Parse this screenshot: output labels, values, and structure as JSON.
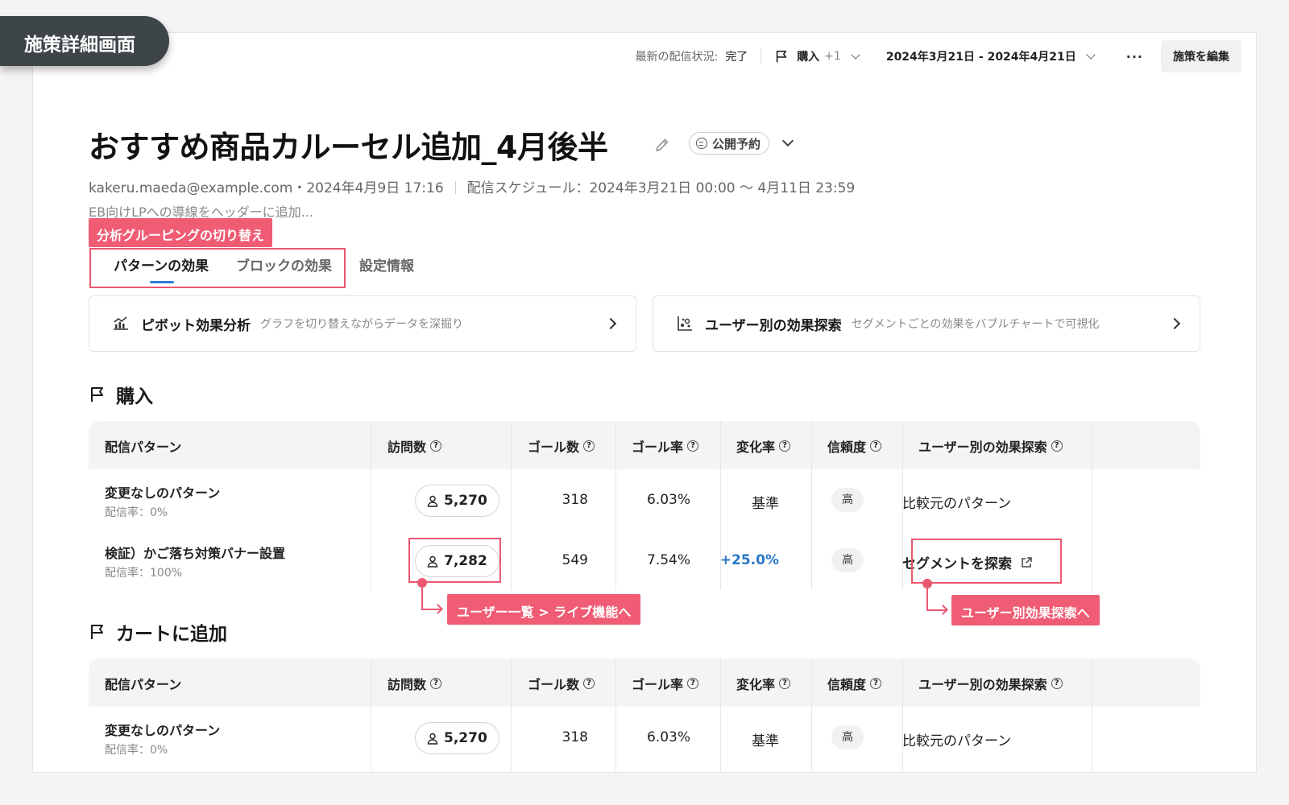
{
  "page_tag": "施策詳細画面",
  "topbar": {
    "status_label": "最新の配信状況:",
    "status_value": "完了",
    "goal_filter": "購入",
    "goal_extra": "+1",
    "date_range": "2024年3月21日 - 2024年4月21日",
    "more": "···",
    "edit_button": "施策を編集"
  },
  "header": {
    "title": "おすすめ商品カルーセル追加_4月後半",
    "status_badge": "公開予約",
    "author_date": "kakeru.maeda@example.com・2024年4月9日 17:16",
    "schedule": "配信スケジュール：2024年3月21日 00:00 〜 4月11日 23:59",
    "description": "EB向けLPへの導線をヘッダーに追加..."
  },
  "annotations": {
    "tabs": "分析グルーピングの切り替え",
    "visits": "ユーザー一覧 > ライブ機能へ",
    "explore": "ユーザー別効果探索へ"
  },
  "tabs": [
    "パターンの効果",
    "ブロックの効果",
    "設定情報"
  ],
  "analysis_cards": [
    {
      "title": "ピボット効果分析",
      "subtitle": "グラフを切り替えながらデータを深掘り",
      "icon": "chart-icon"
    },
    {
      "title": "ユーザー別の効果探索",
      "subtitle": "セグメントごとの効果をバブルチャートで可視化",
      "icon": "bubble-chart-icon"
    }
  ],
  "table_headers": [
    "配信パターン",
    "訪問数",
    "ゴール数",
    "ゴール率",
    "変化率",
    "信頼度",
    "ユーザー別の効果探索"
  ],
  "goals": [
    {
      "title": "購入",
      "rows": [
        {
          "name": "変更なしのパターン",
          "rate": "配信率：0%",
          "visits": "5,270",
          "goals": "318",
          "goal_rate": "6.03%",
          "change": "基準",
          "confidence": "高",
          "explore": "比較元のパターン"
        },
        {
          "name": "検証）かご落ち対策バナー設置",
          "rate": "配信率：100%",
          "visits": "7,282",
          "goals": "549",
          "goal_rate": "7.54%",
          "change": "+25.0%",
          "confidence": "高",
          "explore": "セグメントを探索"
        }
      ]
    },
    {
      "title": "カートに追加",
      "rows": [
        {
          "name": "変更なしのパターン",
          "rate": "配信率：0%",
          "visits": "5,270",
          "goals": "318",
          "goal_rate": "6.03%",
          "change": "基準",
          "confidence": "高",
          "explore": "比較元のパターン"
        }
      ]
    }
  ],
  "colors": {
    "annotation": "#ef5c74",
    "accent_blue": "#2b77c9",
    "tag_bg": "#3d4548"
  }
}
